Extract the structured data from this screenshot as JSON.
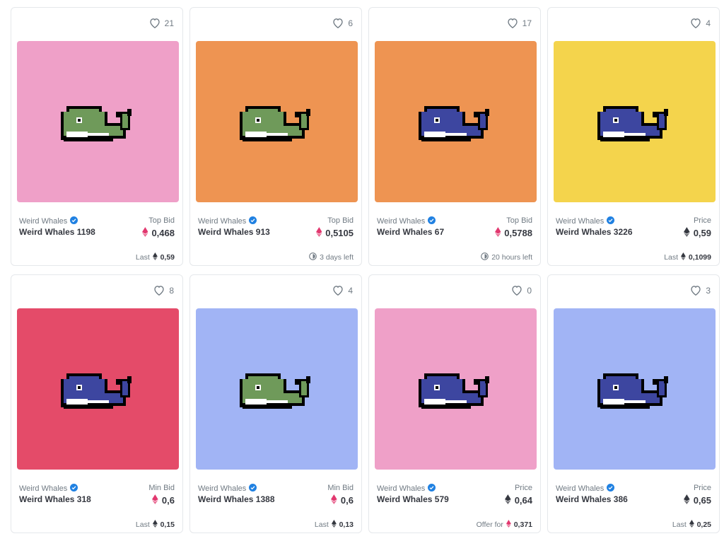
{
  "cards": [
    {
      "likes": "21",
      "bg": "#efa0c8",
      "body": "#6f9a5a",
      "collection": "Weird Whales",
      "name": "Weird Whales 1198",
      "price_label": "Top Bid",
      "price": "0,468",
      "eth": "pink",
      "footer_label": "Last",
      "footer_value": "0,59",
      "footer_icon": "eth"
    },
    {
      "likes": "6",
      "bg": "#ee9452",
      "body": "#6f9a5a",
      "collection": "Weird Whales",
      "name": "Weird Whales 913",
      "price_label": "Top Bid",
      "price": "0,5105",
      "eth": "pink",
      "footer_label": "3 days left",
      "footer_value": "",
      "footer_icon": "clock"
    },
    {
      "likes": "17",
      "bg": "#ee9452",
      "body": "#3d46a0",
      "collection": "Weird Whales",
      "name": "Weird Whales 67",
      "price_label": "Top Bid",
      "price": "0,5788",
      "eth": "pink",
      "footer_label": "20 hours left",
      "footer_value": "",
      "footer_icon": "clock"
    },
    {
      "likes": "4",
      "bg": "#f4d44c",
      "body": "#3d46a0",
      "collection": "Weird Whales",
      "name": "Weird Whales 3226",
      "price_label": "Price",
      "price": "0,59",
      "eth": "dark",
      "footer_label": "Last",
      "footer_value": "0,1099",
      "footer_icon": "eth"
    },
    {
      "likes": "8",
      "bg": "#e44b69",
      "body": "#3d46a0",
      "collection": "Weird Whales",
      "name": "Weird Whales 318",
      "price_label": "Min Bid",
      "price": "0,6",
      "eth": "pink",
      "footer_label": "Last",
      "footer_value": "0,15",
      "footer_icon": "eth"
    },
    {
      "likes": "4",
      "bg": "#a1b4f5",
      "body": "#6f9a5a",
      "collection": "Weird Whales",
      "name": "Weird Whales 1388",
      "price_label": "Min Bid",
      "price": "0,6",
      "eth": "pink",
      "footer_label": "Last",
      "footer_value": "0,13",
      "footer_icon": "eth"
    },
    {
      "likes": "0",
      "bg": "#efa0c8",
      "body": "#3d46a0",
      "collection": "Weird Whales",
      "name": "Weird Whales 579",
      "price_label": "Price",
      "price": "0,64",
      "eth": "dark",
      "footer_label": "Offer for",
      "footer_value": "0,371",
      "footer_icon": "eth-pink"
    },
    {
      "likes": "3",
      "bg": "#a1b4f5",
      "body": "#3d46a0",
      "collection": "Weird Whales",
      "name": "Weird Whales 386",
      "price_label": "Price",
      "price": "0,65",
      "eth": "dark",
      "footer_label": "Last",
      "footer_value": "0,25",
      "footer_icon": "eth"
    }
  ],
  "icons": {
    "like": "heart-icon",
    "verified": "verified-badge-icon",
    "currency": "ethereum-icon",
    "timer": "clock-icon"
  },
  "colors": {
    "verified": "#2081e2",
    "eth_pink": "#e2386f",
    "eth_dark": "#353840",
    "text_muted": "#707a83"
  }
}
